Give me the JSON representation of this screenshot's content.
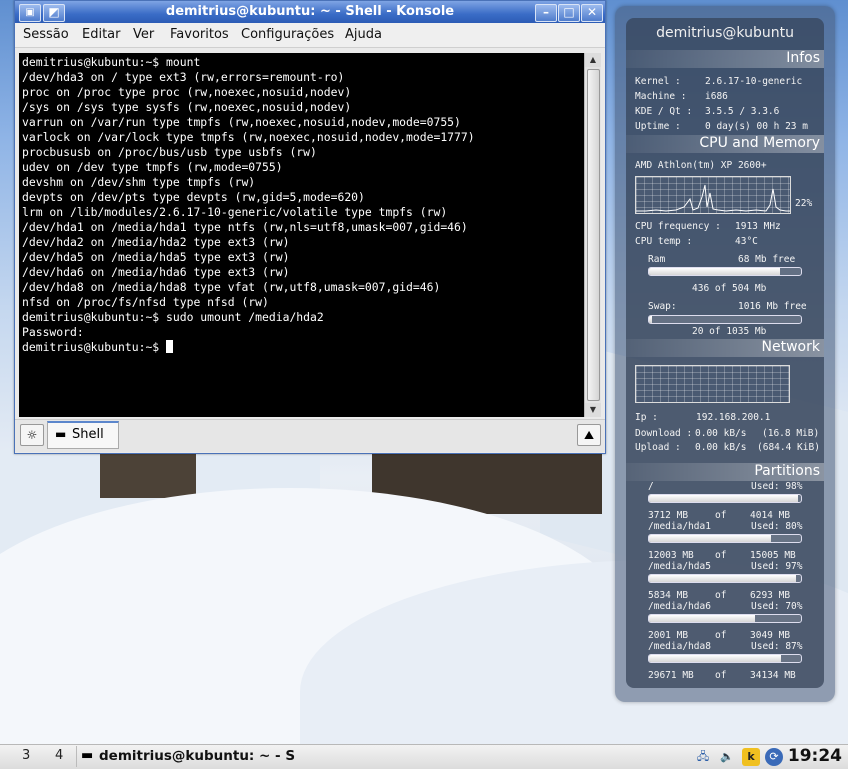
{
  "window": {
    "title": "demitrius@kubuntu: ~ - Shell - Konsole",
    "menu": [
      "Sessão",
      "Editar",
      "Ver",
      "Favoritos",
      "Configurações",
      "Ajuda"
    ],
    "tab_label": "Shell"
  },
  "terminal": {
    "lines": [
      "demitrius@kubuntu:~$ mount",
      "/dev/hda3 on / type ext3 (rw,errors=remount-ro)",
      "proc on /proc type proc (rw,noexec,nosuid,nodev)",
      "/sys on /sys type sysfs (rw,noexec,nosuid,nodev)",
      "varrun on /var/run type tmpfs (rw,noexec,nosuid,nodev,mode=0755)",
      "varlock on /var/lock type tmpfs (rw,noexec,nosuid,nodev,mode=1777)",
      "procbususb on /proc/bus/usb type usbfs (rw)",
      "udev on /dev type tmpfs (rw,mode=0755)",
      "devshm on /dev/shm type tmpfs (rw)",
      "devpts on /dev/pts type devpts (rw,gid=5,mode=620)",
      "lrm on /lib/modules/2.6.17-10-generic/volatile type tmpfs (rw)",
      "/dev/hda1 on /media/hda1 type ntfs (rw,nls=utf8,umask=007,gid=46)",
      "/dev/hda2 on /media/hda2 type ext3 (rw)",
      "/dev/hda5 on /media/hda5 type ext3 (rw)",
      "/dev/hda6 on /media/hda6 type ext3 (rw)",
      "/dev/hda8 on /media/hda8 type vfat (rw,utf8,umask=007,gid=46)",
      "nfsd on /proc/fs/nfsd type nfsd (rw)",
      "demitrius@kubuntu:~$ sudo umount /media/hda2",
      "Password:"
    ],
    "prompt": "demitrius@kubuntu:~$ "
  },
  "panel": {
    "host": "demitrius@kubuntu",
    "infos_title": "Infos",
    "infos": [
      {
        "k": "Kernel :",
        "v": "2.6.17-10-generic"
      },
      {
        "k": "Machine :",
        "v": "i686"
      },
      {
        "k": "KDE / Qt :",
        "v": "3.5.5    /    3.3.6"
      },
      {
        "k": "Uptime :",
        "v": "0 day(s)  00 h 23 m"
      }
    ],
    "cpu_title": "CPU and Memory",
    "cpu_name": "AMD Athlon(tm) XP 2600+",
    "cpu_percent": "22%",
    "cpu_freq_label": "CPU frequency :",
    "cpu_freq": "1913 MHz",
    "cpu_temp_label": "CPU temp :",
    "cpu_temp": "43°C",
    "ram_label": "Ram",
    "ram_free": "68 Mb free",
    "ram_used": "436 of 504 Mb",
    "ram_fraction": 0.865,
    "swap_label": "Swap:",
    "swap_free": "1016 Mb free",
    "swap_used": "20 of 1035 Mb",
    "swap_fraction": 0.02,
    "net_title": "Network",
    "ip_label": "Ip :",
    "ip": "192.168.200.1",
    "download_label": "Download :",
    "download": "0.00 kB/s",
    "download_total": "(16.8 MiB)",
    "upload_label": "Upload :",
    "upload": "0.00 kB/s",
    "upload_total": "(684.4 KiB)",
    "part_title": "Partitions",
    "partitions": [
      {
        "name": "/",
        "used": "Used: 98%",
        "fraction": 0.98,
        "a": "3712 MB",
        "b": "4014 MB"
      },
      {
        "name": "/media/hda1",
        "used": "Used: 80%",
        "fraction": 0.8,
        "a": "12003 MB",
        "b": "15005 MB"
      },
      {
        "name": "/media/hda5",
        "used": "Used: 97%",
        "fraction": 0.97,
        "a": "5834 MB",
        "b": "6293 MB"
      },
      {
        "name": "/media/hda6",
        "used": "Used: 70%",
        "fraction": 0.7,
        "a": "2001 MB",
        "b": "3049 MB"
      },
      {
        "name": "/media/hda8",
        "used": "Used: 87%",
        "fraction": 0.87,
        "a": "29671 MB",
        "b": "34134 MB"
      }
    ],
    "of": "of"
  },
  "taskbar": {
    "desktops": [
      "3",
      "4"
    ],
    "task_label": "demitrius@kubuntu: ~ - S",
    "clock": "19:24"
  }
}
